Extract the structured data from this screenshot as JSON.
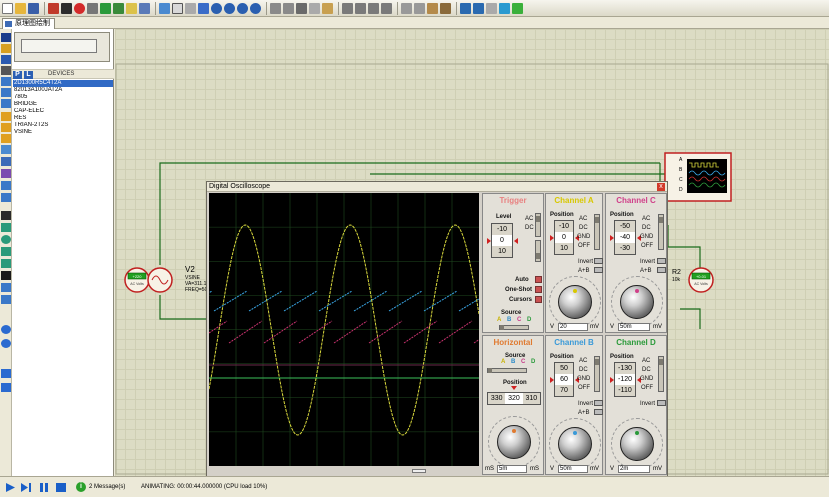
{
  "tab": {
    "title": "原理图绘制"
  },
  "device_panel": {
    "btn_p": "P",
    "btn_l": "L",
    "title": "DEVICES",
    "items": [
      "2D1300R5C4T2A",
      "82013A100JAT2A",
      "7805",
      "BRIDGE",
      "CAP-ELEC",
      "RES",
      "TRIAN-2T2S",
      "VSINE"
    ],
    "selected_index": 0
  },
  "schematic": {
    "v2_label": "V2",
    "v2_line1": "VSINE",
    "v2_line2": "VA=311.1",
    "v2_line3": "FREQ=50",
    "r2_label": "R2",
    "r2_value": "10k",
    "meter_left": "AC Volts",
    "meter_right": "AC Volts",
    "meter_right_value": "+0.01",
    "meter_left_value": "+220",
    "osc_pins": [
      "A",
      "B",
      "C",
      "D"
    ]
  },
  "scope": {
    "title": "Digital Oscilloscope",
    "close_label": "x",
    "trigger": {
      "title": "Trigger",
      "level_label": "Level",
      "level_values": [
        "-10",
        "0",
        "10"
      ],
      "ac_label": "AC",
      "dc_label": "DC",
      "auto_label": "Auto",
      "oneshot_label": "One-Shot",
      "cursors_label": "Cursors",
      "source_label": "Source",
      "source_letters": [
        "A",
        "B",
        "C",
        "D"
      ]
    },
    "channel_a": {
      "title": "Channel A",
      "position_label": "Position",
      "values": [
        "-10",
        "0",
        "10"
      ],
      "modes": [
        "AC",
        "DC",
        "GND",
        "OFF"
      ],
      "invert_label": "Invert",
      "sum_label": "A+B",
      "readout": "20",
      "unit": "mV",
      "v_label": "V",
      "color": "#e8e84a"
    },
    "channel_c": {
      "title": "Channel C",
      "position_label": "Position",
      "values": [
        "-50",
        "-40",
        "-30"
      ],
      "modes": [
        "AC",
        "DC",
        "GND",
        "OFF"
      ],
      "invert_label": "Invert",
      "sum_label": "A+B",
      "readout": "50m",
      "unit": "mV",
      "v_label": "V",
      "color": "#e85aa0"
    },
    "horizontal": {
      "title": "Horizontal",
      "source_label": "Source",
      "source_letters": [
        "A",
        "B",
        "C",
        "D"
      ],
      "position_label": "Position",
      "position_values": [
        "330",
        "320",
        "310"
      ],
      "readout": "5m",
      "unit": "mS",
      "ms_label": "mS",
      "color": "#e07a30"
    },
    "channel_b": {
      "title": "Channel B",
      "position_label": "Position",
      "values": [
        "50",
        "60",
        "70"
      ],
      "modes": [
        "AC",
        "DC",
        "GND",
        "OFF"
      ],
      "invert_label": "Invert",
      "sum_label": "A+B",
      "readout": "50m",
      "unit": "mV",
      "v_label": "V",
      "color": "#4aa8e0"
    },
    "channel_d": {
      "title": "Channel D",
      "position_label": "Position",
      "values": [
        "-130",
        "-120",
        "-110"
      ],
      "modes": [
        "AC",
        "DC",
        "GND",
        "OFF"
      ],
      "invert_label": "Invert",
      "readout": "2m",
      "unit": "mV",
      "v_label": "V",
      "color": "#3cbf5a"
    }
  },
  "status": {
    "messages": "2 Message(s)",
    "animating": "ANIMATING: 00:00:44.000000 (CPU load 10%)"
  },
  "colors": {
    "trace_a": "#d8d83c",
    "trace_b": "#3aa8e8",
    "trace_c": "#c8326e",
    "trace_d": "#2f9a3c",
    "wire": "#1a6b1a",
    "component_red": "#c02020"
  }
}
